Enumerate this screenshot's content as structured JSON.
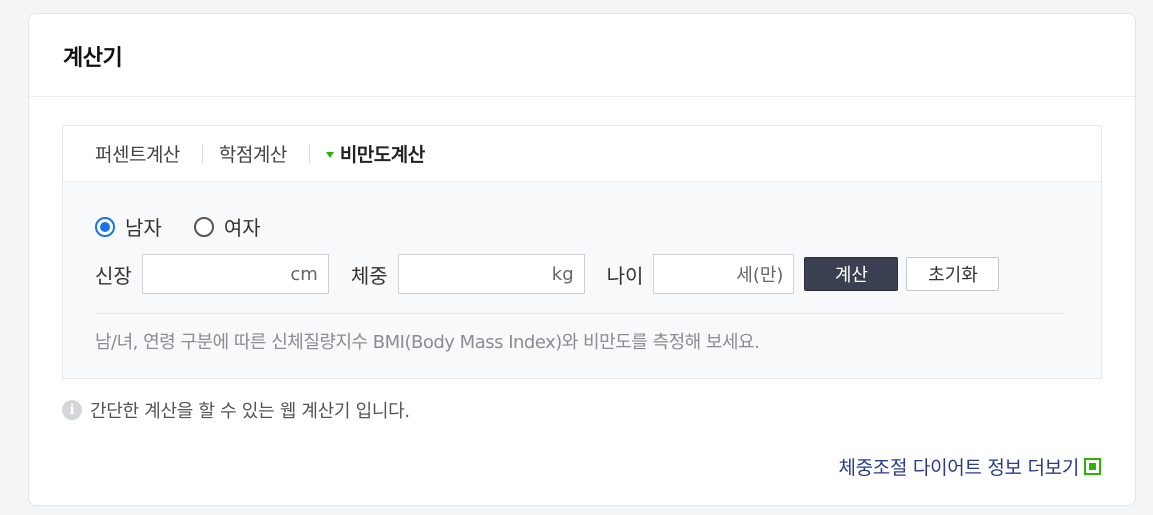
{
  "card": {
    "title": "계산기"
  },
  "tabs": [
    {
      "label": "퍼센트계산",
      "active": false
    },
    {
      "label": "학점계산",
      "active": false
    },
    {
      "label": "비만도계산",
      "active": true
    }
  ],
  "gender": {
    "options": [
      {
        "label": "남자",
        "checked": true
      },
      {
        "label": "여자",
        "checked": false
      }
    ]
  },
  "fields": {
    "height": {
      "label": "신장",
      "unit": "cm",
      "value": ""
    },
    "weight": {
      "label": "체중",
      "unit": "kg",
      "value": ""
    },
    "age": {
      "label": "나이",
      "unit": "세(만)",
      "value": ""
    }
  },
  "buttons": {
    "calc": "계산",
    "reset": "초기화"
  },
  "description": "남/녀, 연령 구분에 따른 신체질량지수 BMI(Body Mass Index)와 비만도를 측정해 보세요.",
  "info": {
    "icon": "i",
    "text": "간단한 계산을 할 수 있는 웹 계산기 입니다."
  },
  "more_link": {
    "label": "체중조절 다이어트 정보 더보기",
    "icon": "external-link-icon"
  },
  "colors": {
    "accent_green": "#2db400",
    "link_blue": "#2a3a8c",
    "radio_blue": "#1a73e8",
    "calc_button": "#3b3f52"
  }
}
